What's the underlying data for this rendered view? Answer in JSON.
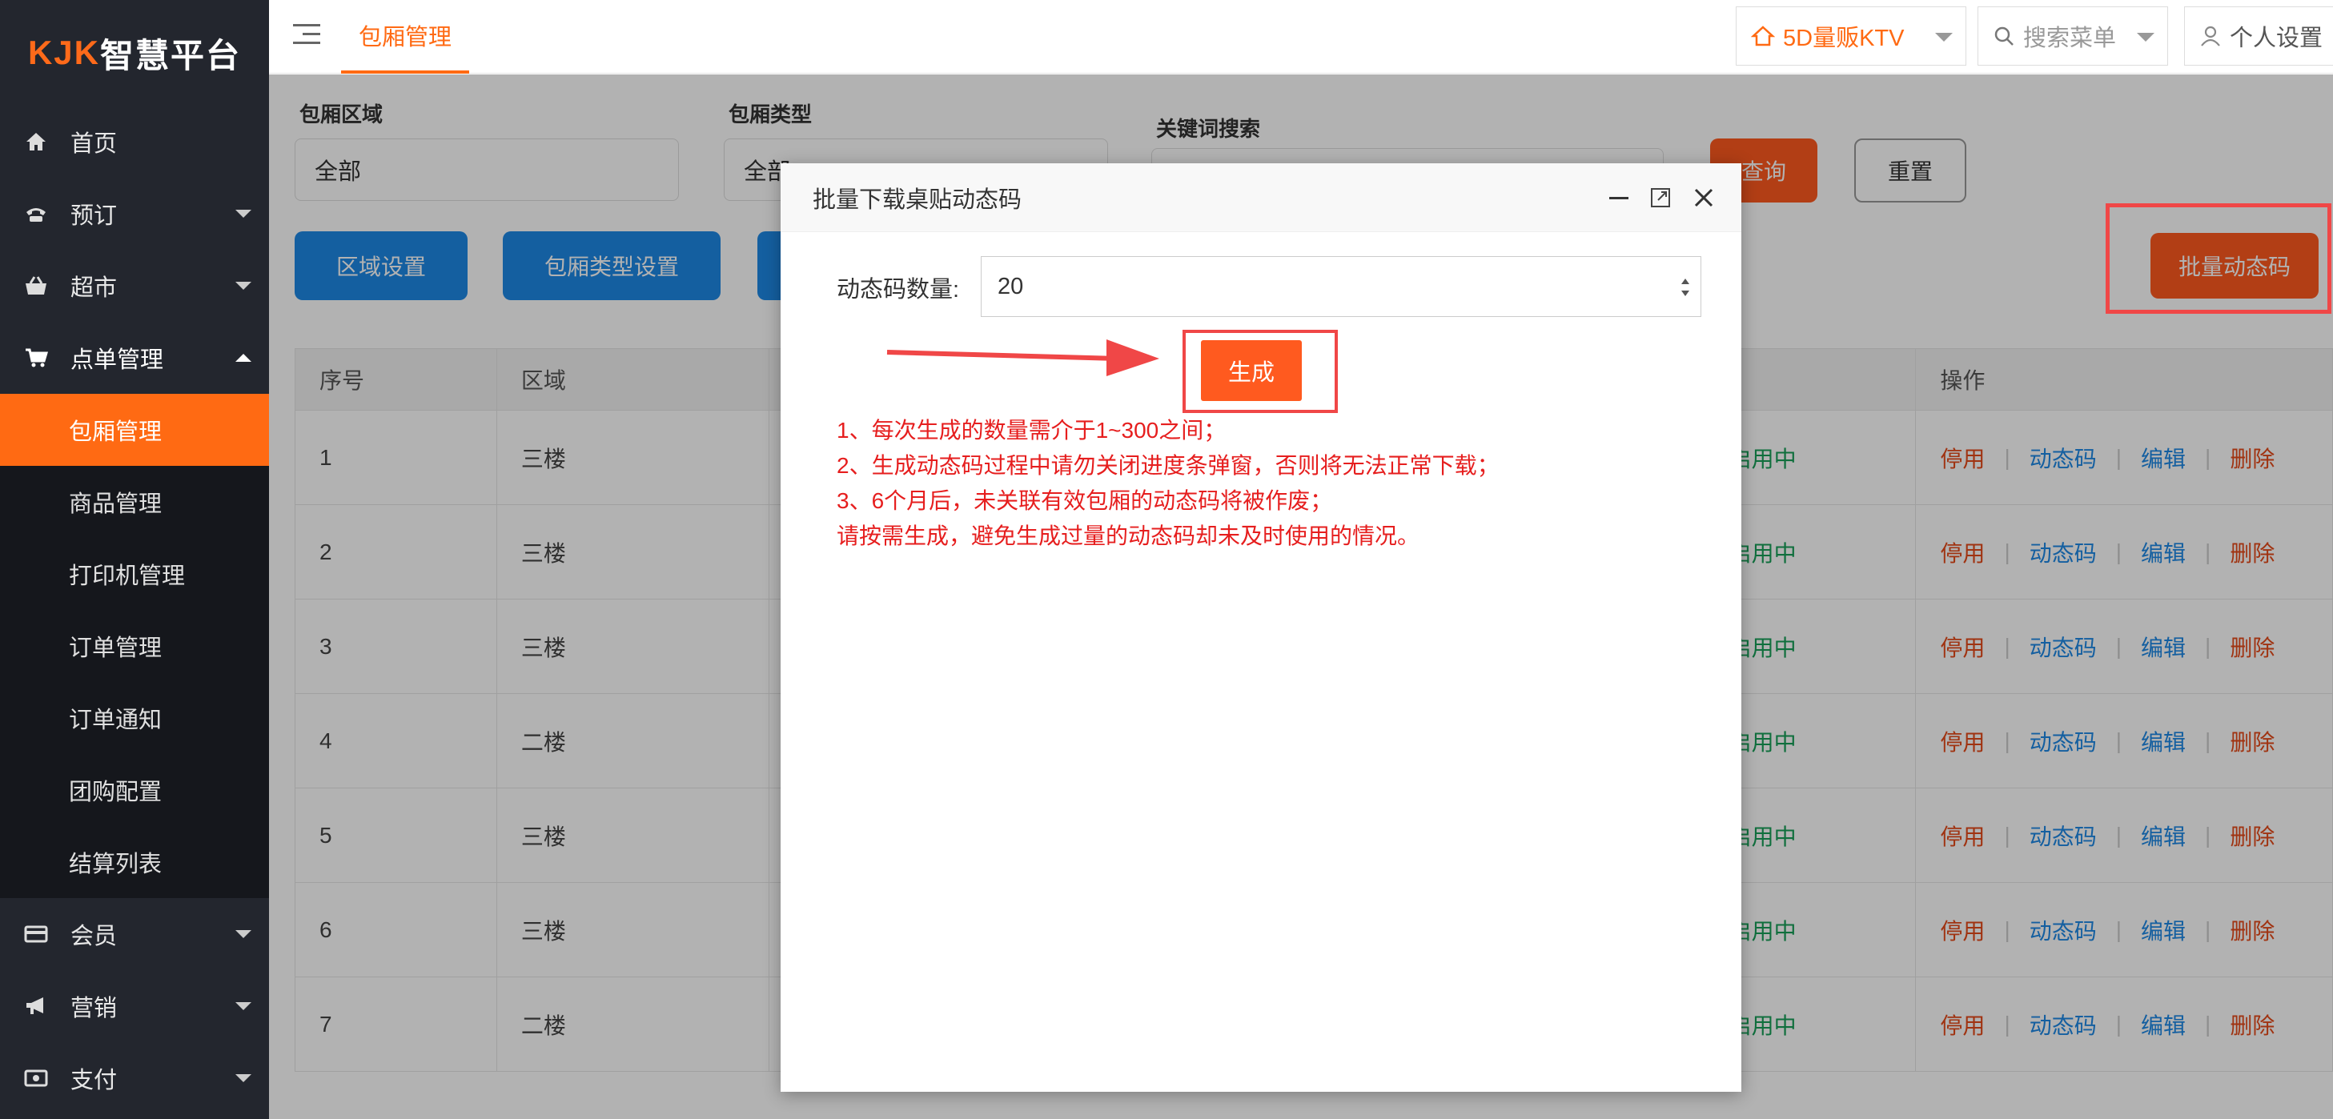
{
  "brand": {
    "logo_prefix": "KJK",
    "logo_text": "智慧平台"
  },
  "sidebar": {
    "items": [
      {
        "label": "首页"
      },
      {
        "label": "预订"
      },
      {
        "label": "超市"
      },
      {
        "label": "点单管理"
      },
      {
        "label": "会员"
      },
      {
        "label": "营销"
      },
      {
        "label": "支付"
      }
    ],
    "sub_items": [
      {
        "label": "包厢管理"
      },
      {
        "label": "商品管理"
      },
      {
        "label": "打印机管理"
      },
      {
        "label": "订单管理"
      },
      {
        "label": "订单通知"
      },
      {
        "label": "团购配置"
      },
      {
        "label": "结算列表"
      }
    ]
  },
  "topbar": {
    "active_tab": "包厢管理",
    "store": "5D量贩KTV",
    "search_placeholder": "搜索菜单",
    "user_settings": "个人设置"
  },
  "filters": {
    "area_label": "包厢区域",
    "area_value": "全部",
    "type_label": "包厢类型",
    "type_value": "全部",
    "keyword_label": "关键词搜索",
    "query_button": "查询",
    "reset_button": "重置"
  },
  "actions": {
    "area_settings": "区域设置",
    "type_settings": "包厢类型设置",
    "batch_code": "批量动态码"
  },
  "table": {
    "headers": [
      "序号",
      "区域",
      "",
      "",
      "",
      "",
      "操作"
    ],
    "rows": [
      {
        "no": "1",
        "area": "三楼",
        "status": "启用中"
      },
      {
        "no": "2",
        "area": "三楼",
        "status": "启用中"
      },
      {
        "no": "3",
        "area": "三楼",
        "status": "启用中"
      },
      {
        "no": "4",
        "area": "二楼",
        "status": "启用中"
      },
      {
        "no": "5",
        "area": "三楼",
        "status": "启用中"
      },
      {
        "no": "6",
        "area": "三楼",
        "status": "启用中"
      },
      {
        "no": "7",
        "area": "二楼",
        "status": "启用中"
      }
    ],
    "ops": {
      "disable": "停用",
      "code": "动态码",
      "edit": "编辑",
      "delete": "删除"
    }
  },
  "modal": {
    "title": "批量下载桌贴动态码",
    "count_label": "动态码数量:",
    "count_value": "20",
    "generate_button": "生成",
    "notes": [
      "1、每次生成的数量需介于1~300之间；",
      "2、生成动态码过程中请勿关闭进度条弹窗，否则将无法正常下载；",
      "3、6个月后，未关联有效包厢的动态码将被作废；",
      "请按需生成，避免生成过量的动态码却未及时使用的情况。"
    ]
  },
  "colors": {
    "accent": "#ff6a13",
    "primary": "#1e88e5",
    "danger": "#e61e1e",
    "success": "#18a058"
  }
}
